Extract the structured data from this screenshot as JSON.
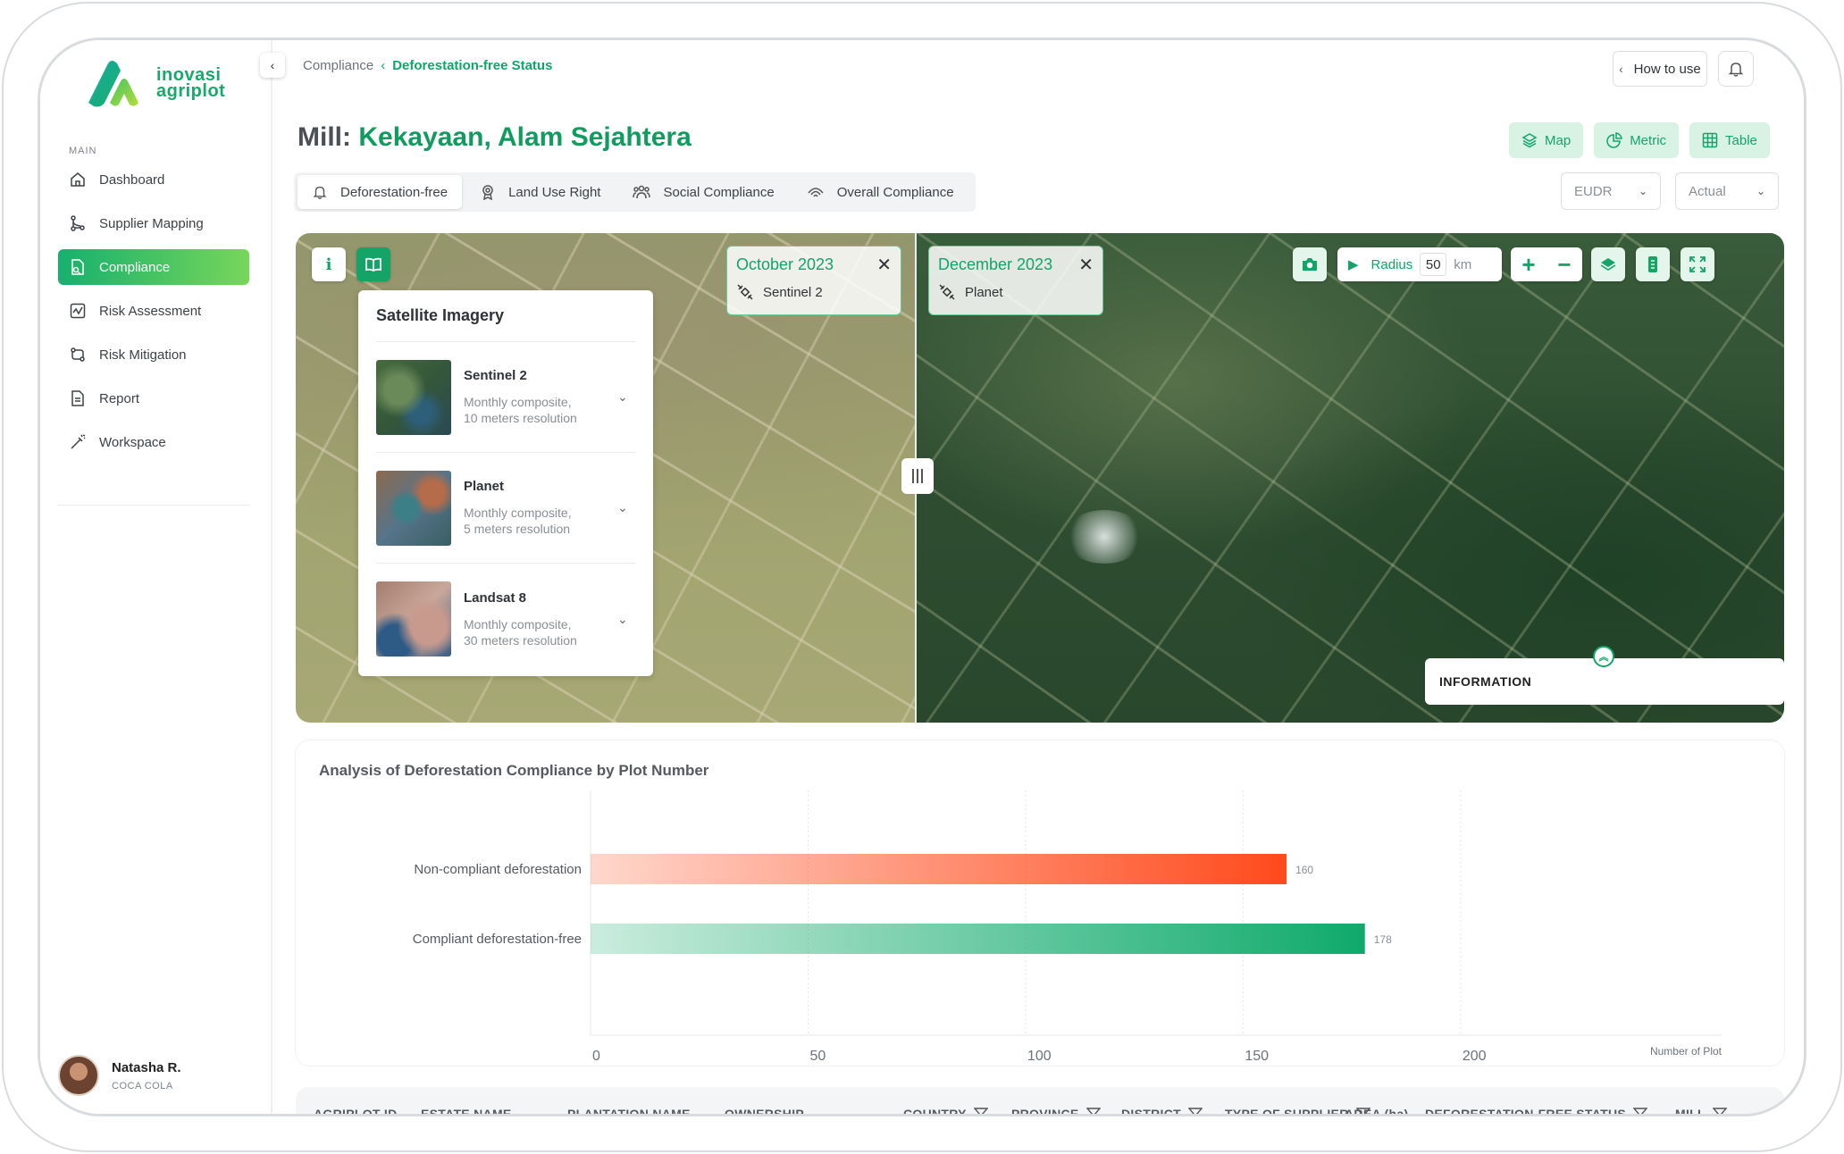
{
  "brand": {
    "line1": "inovasi",
    "line2": "agriplot"
  },
  "sidebar": {
    "section_label": "MAIN",
    "items": [
      {
        "label": "Dashboard",
        "icon": "home-icon"
      },
      {
        "label": "Supplier Mapping",
        "icon": "supplier-mapping-icon"
      },
      {
        "label": "Compliance",
        "icon": "compliance-icon",
        "active": true
      },
      {
        "label": "Risk Assessment",
        "icon": "chart-icon"
      },
      {
        "label": "Risk Mitigation",
        "icon": "risk-mitigation-icon"
      },
      {
        "label": "Report",
        "icon": "report-icon"
      },
      {
        "label": "Workspace",
        "icon": "workspace-icon"
      }
    ],
    "user": {
      "name": "Natasha R.",
      "org": "COCA COLA"
    }
  },
  "header": {
    "breadcrumb_parent": "Compliance",
    "breadcrumb_current": "Deforestation-free Status",
    "how_to_use": "How to use"
  },
  "page": {
    "title_prefix": "Mill:",
    "mill_name": "Kekayaan, Alam Sejahtera",
    "view_buttons": {
      "map": "Map",
      "metric": "Metric",
      "table": "Table"
    },
    "tabs": [
      "Deforestation-free",
      "Land Use Right",
      "Social Compliance",
      "Overall Compliance"
    ],
    "regulation_select": "EUDR",
    "mode_select": "Actual"
  },
  "map": {
    "panel_title": "Satellite Imagery",
    "sources": [
      {
        "name": "Sentinel 2",
        "desc1": "Monthly composite,",
        "desc2": "10 meters resolution"
      },
      {
        "name": "Planet",
        "desc1": "Monthly composite,",
        "desc2": "5 meters resolution"
      },
      {
        "name": "Landsat 8",
        "desc1": "Monthly composite,",
        "desc2": "30 meters resolution"
      }
    ],
    "left_date": "October 2023",
    "left_source": "Sentinel 2",
    "right_date": "December 2023",
    "right_source": "Planet",
    "radius_label": "Radius",
    "radius_value": "50",
    "radius_unit": "km",
    "information_label": "INFORMATION"
  },
  "chart_data": {
    "type": "bar",
    "orientation": "horizontal",
    "title": "Analysis of Deforestation Compliance by Plot Number",
    "categories": [
      "Non-compliant deforestation",
      "Compliant deforestation-free"
    ],
    "values": [
      160,
      178
    ],
    "colors": [
      "#ff4a1c",
      "#0faa6b"
    ],
    "xlabel": "Number of Plot",
    "xlim": [
      0,
      260
    ],
    "xticks": [
      0,
      50,
      100,
      150,
      200
    ],
    "grid": true
  },
  "table": {
    "columns": [
      {
        "label": "AGRIPLOT ID",
        "filter": false
      },
      {
        "label": "ESTATE NAME",
        "filter": false
      },
      {
        "label": "PLANTATION NAME",
        "filter": false
      },
      {
        "label": "OWNERSHIP",
        "filter": false
      },
      {
        "label": "COUNTRY",
        "filter": true
      },
      {
        "label": "PROVINCE",
        "filter": true
      },
      {
        "label": "DISTRICT",
        "filter": true
      },
      {
        "label": "TYPE OF SUPPLIER",
        "filter": true
      },
      {
        "label": "AREA (ha)",
        "filter": false
      },
      {
        "label": "DEFORESTATION-FREE STATUS",
        "filter": true
      },
      {
        "label": "MILL",
        "filter": true
      }
    ]
  }
}
